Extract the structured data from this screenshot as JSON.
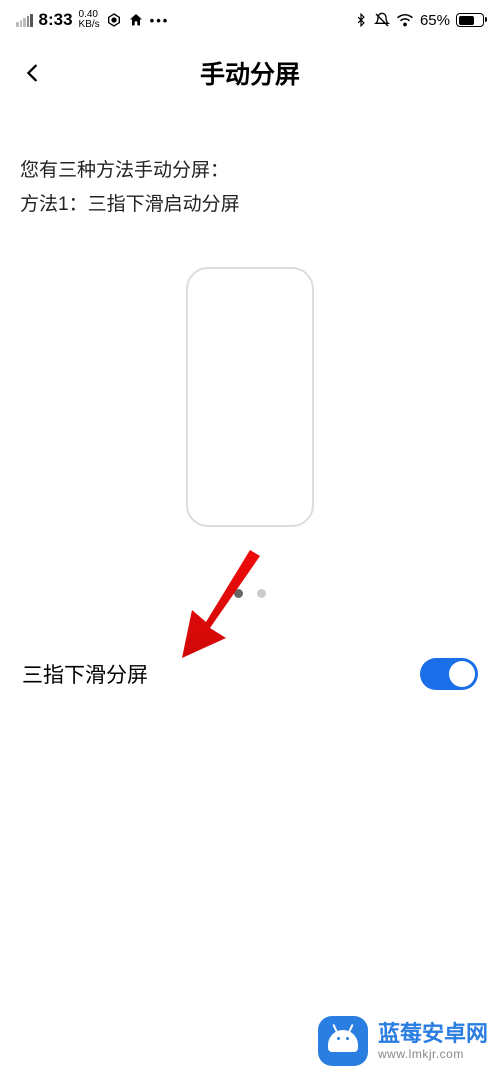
{
  "status_bar": {
    "time": "8:33",
    "net_speed_top": "0.40",
    "net_speed_bottom": "KB/s",
    "dots": "•••",
    "battery_pct": "65%"
  },
  "header": {
    "title": "手动分屏"
  },
  "description": {
    "line1": "您有三种方法手动分屏：",
    "line2": "方法1：三指下滑启动分屏"
  },
  "setting": {
    "label": "三指下滑分屏",
    "enabled": true
  },
  "watermark": {
    "title": "蓝莓安卓网",
    "url": "www.lmkjr.com"
  },
  "colors": {
    "accent": "#1a6fe8",
    "arrow": "#ee0b0b"
  }
}
